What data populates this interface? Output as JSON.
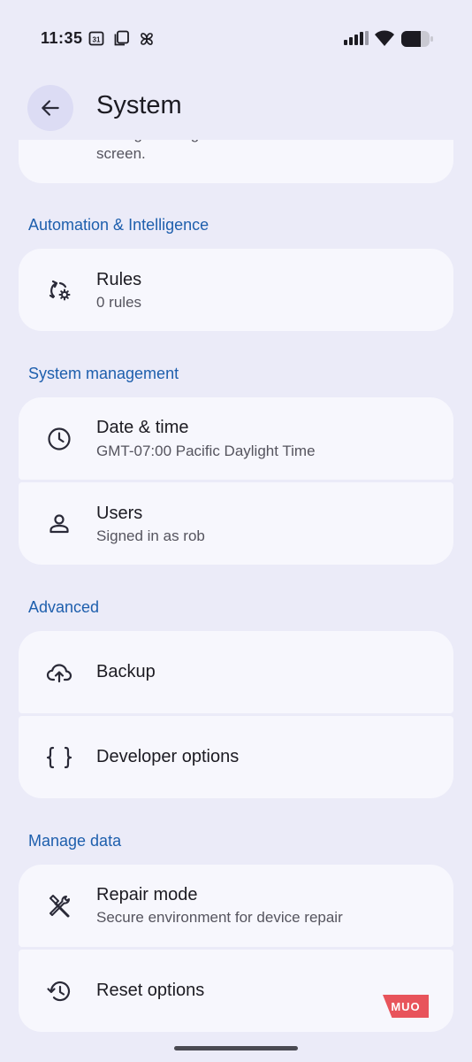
{
  "status_bar": {
    "time": "11:35",
    "icons": [
      "calendar-icon",
      "screenshot-icon",
      "pinwheel-icon",
      "cellular-signal-icon",
      "wifi-icon",
      "battery-icon"
    ],
    "calendar_day": "31"
  },
  "header": {
    "title": "System",
    "back_icon": "arrow-left-icon"
  },
  "partial_card": {
    "text_line_1": "Manage settings related to the lock",
    "text_line_2": "screen."
  },
  "sections": [
    {
      "header": "Automation & Intelligence",
      "items": [
        {
          "icon": "rules-sync-gear-icon",
          "title": "Rules",
          "subtitle": "0 rules"
        }
      ]
    },
    {
      "header": "System management",
      "items": [
        {
          "icon": "clock-icon",
          "title": "Date & time",
          "subtitle": "GMT-07:00 Pacific Daylight Time"
        },
        {
          "icon": "person-icon",
          "title": "Users",
          "subtitle": "Signed in as rob"
        }
      ]
    },
    {
      "header": "Advanced",
      "items": [
        {
          "icon": "cloud-upload-icon",
          "title": "Backup"
        },
        {
          "icon": "curly-braces-icon",
          "title": "Developer options"
        }
      ]
    },
    {
      "header": "Manage data",
      "items": [
        {
          "icon": "repair-tools-icon",
          "title": "Repair mode",
          "subtitle": "Secure environment for device repair"
        },
        {
          "icon": "history-icon",
          "title": "Reset options"
        }
      ]
    }
  ],
  "watermark": "MUO",
  "colors": {
    "background": "#ebebf8",
    "card": "#f7f7fd",
    "section_header": "#1e5fad",
    "back_button": "#dcdcf4"
  }
}
